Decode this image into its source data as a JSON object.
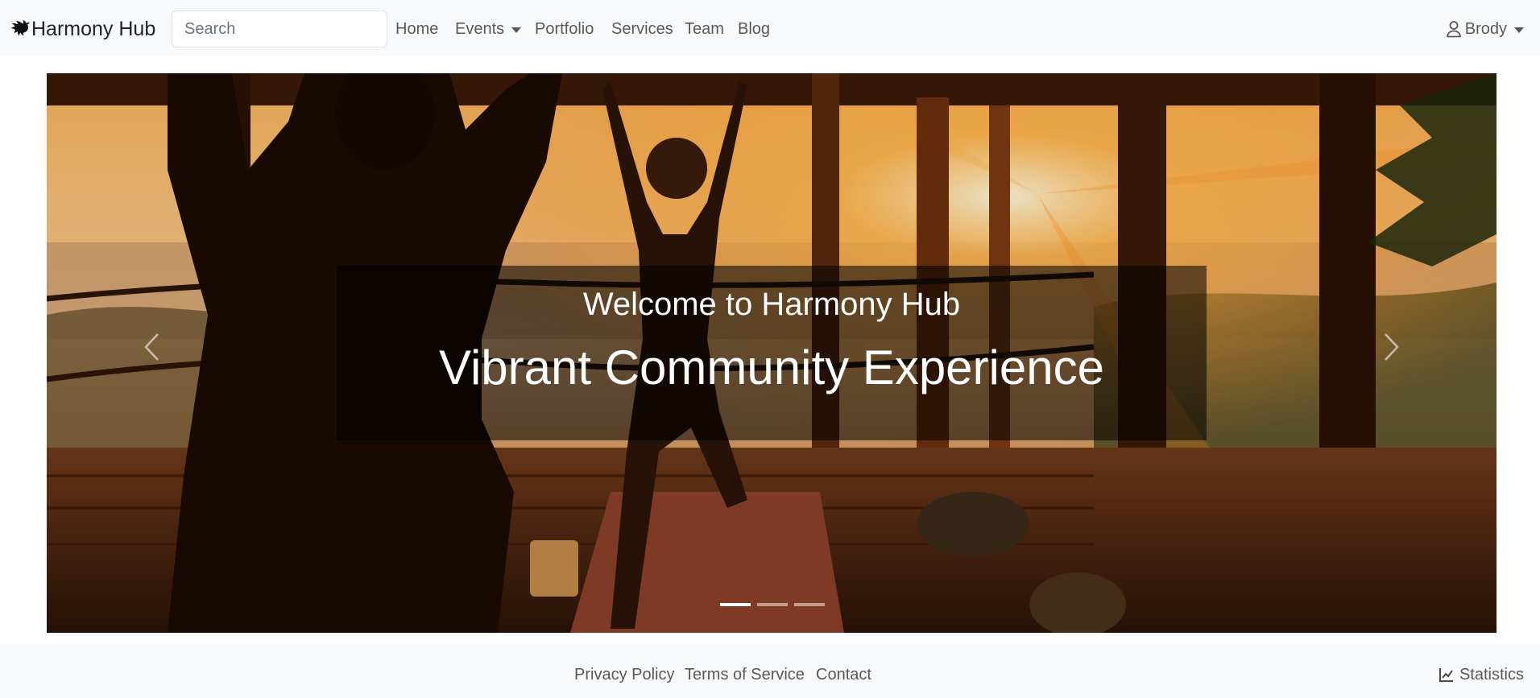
{
  "navbar": {
    "brand": "Harmony Hub",
    "brand_icon": "dove-icon",
    "search_placeholder": "Search",
    "links": {
      "home": "Home",
      "events": "Events",
      "portfolio": "Portfolio",
      "services": "Services",
      "team": "Team",
      "blog": "Blog"
    },
    "user": {
      "name": "Brody",
      "icon": "person-icon"
    }
  },
  "carousel": {
    "caption_subtitle": "Welcome to Harmony Hub",
    "caption_title": "Vibrant Community Experience",
    "image": "yoga-class-sunset-photo",
    "slide_count": 3,
    "active_slide": 1
  },
  "footer": {
    "links": {
      "privacy": "Privacy Policy",
      "terms": "Terms of Service",
      "contact": "Contact"
    },
    "stats": "Statistics",
    "stats_icon": "line-chart-icon"
  }
}
